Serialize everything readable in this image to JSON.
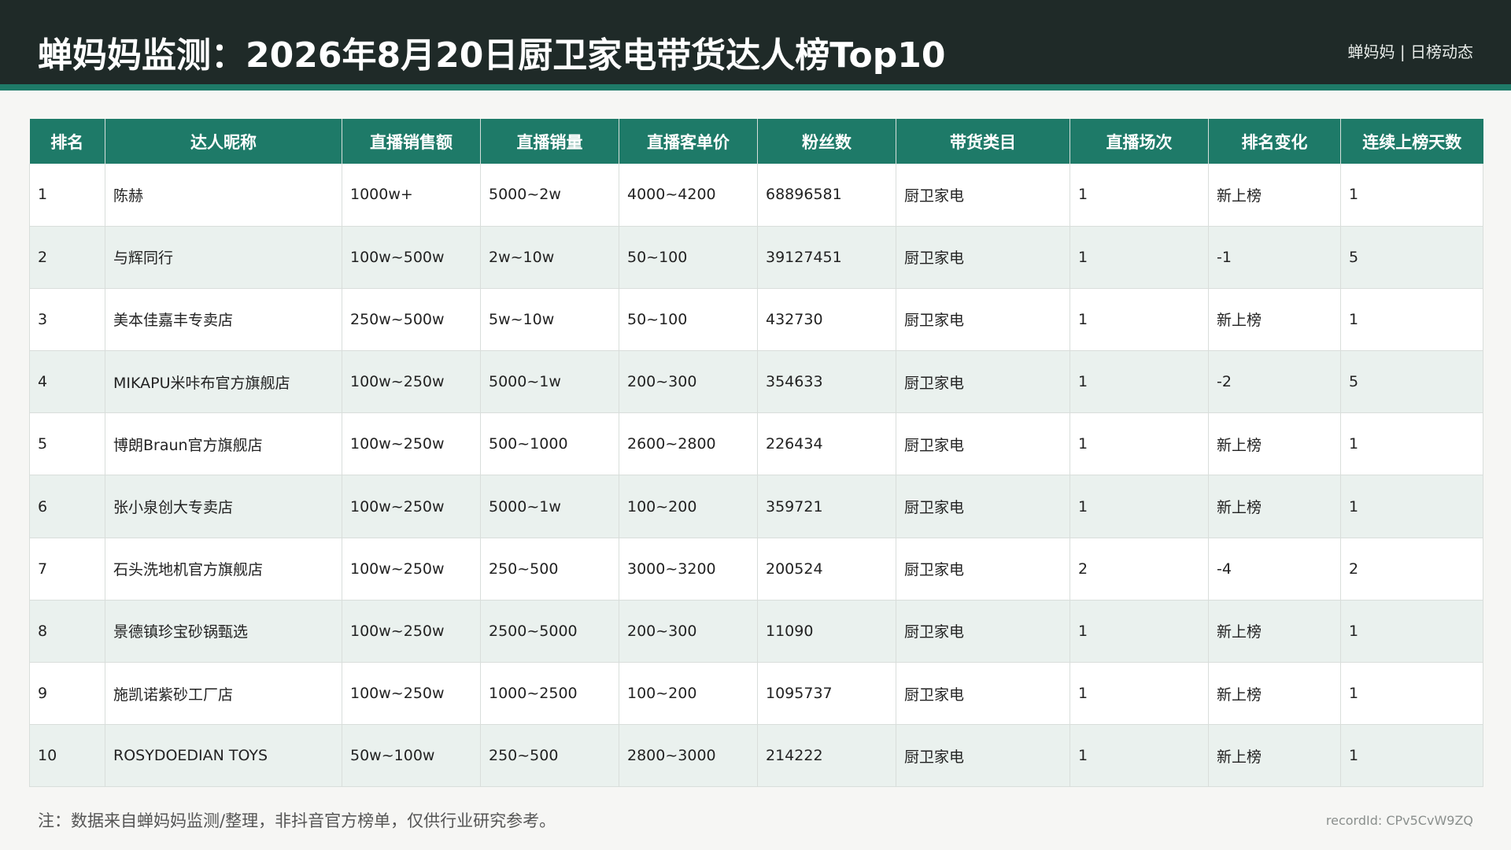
{
  "header": {
    "title": "蝉妈妈监测：2026年8月20日厨卫家电带货达人榜Top10",
    "brand": "蝉妈妈 | 日榜动态"
  },
  "table": {
    "columns": [
      "排名",
      "达人昵称",
      "直播销售额",
      "直播销量",
      "直播客单价",
      "粉丝数",
      "带货类目",
      "直播场次",
      "排名变化",
      "连续上榜天数"
    ],
    "rows": [
      [
        "1",
        "陈赫",
        "1000w+",
        "5000~2w",
        "4000~4200",
        "68896581",
        "厨卫家电",
        "1",
        "新上榜",
        "1"
      ],
      [
        "2",
        "与辉同行",
        "100w~500w",
        "2w~10w",
        "50~100",
        "39127451",
        "厨卫家电",
        "1",
        "-1",
        "5"
      ],
      [
        "3",
        "美本佳嘉丰专卖店",
        "250w~500w",
        "5w~10w",
        "50~100",
        "432730",
        "厨卫家电",
        "1",
        "新上榜",
        "1"
      ],
      [
        "4",
        "MIKAPU米咔布官方旗舰店",
        "100w~250w",
        "5000~1w",
        "200~300",
        "354633",
        "厨卫家电",
        "1",
        "-2",
        "5"
      ],
      [
        "5",
        "博朗Braun官方旗舰店",
        "100w~250w",
        "500~1000",
        "2600~2800",
        "226434",
        "厨卫家电",
        "1",
        "新上榜",
        "1"
      ],
      [
        "6",
        "张小泉创大专卖店",
        "100w~250w",
        "5000~1w",
        "100~200",
        "359721",
        "厨卫家电",
        "1",
        "新上榜",
        "1"
      ],
      [
        "7",
        "石头洗地机官方旗舰店",
        "100w~250w",
        "250~500",
        "3000~3200",
        "200524",
        "厨卫家电",
        "2",
        "-4",
        "2"
      ],
      [
        "8",
        "景德镇珍宝砂锅甄选",
        "100w~250w",
        "2500~5000",
        "200~300",
        "11090",
        "厨卫家电",
        "1",
        "新上榜",
        "1"
      ],
      [
        "9",
        "施凯诺紫砂工厂店",
        "100w~250w",
        "1000~2500",
        "100~200",
        "1095737",
        "厨卫家电",
        "1",
        "新上榜",
        "1"
      ],
      [
        "10",
        "ROSYDOEDIAN TOYS",
        "50w~100w",
        "250~500",
        "2800~3000",
        "214222",
        "厨卫家电",
        "1",
        "新上榜",
        "1"
      ]
    ]
  },
  "footer": {
    "note": "注：数据来自蝉妈妈监测/整理，非抖音官方榜单，仅供行业研究参考。",
    "record_id": "recordId: CPv5CvW9ZQ"
  },
  "colors": {
    "header_bg": "#1f2a28",
    "accent": "#1e7a68",
    "row_alt": "#eaf1ee"
  }
}
